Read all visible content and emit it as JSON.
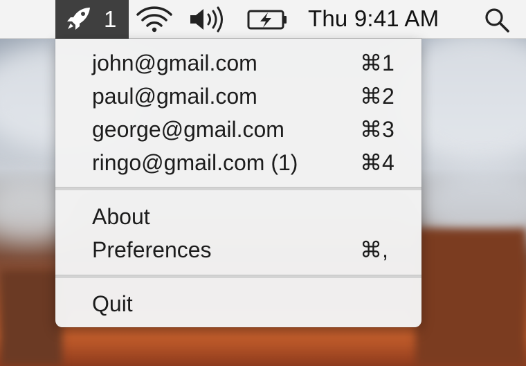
{
  "menubar": {
    "status_app": {
      "icon": "rocket-icon",
      "unread_count": "1"
    },
    "tray": {
      "wifi_icon": "wifi-icon",
      "volume_icon": "volume-icon",
      "battery_icon": "battery-charging-icon",
      "search_icon": "search-icon"
    },
    "clock": "Thu 9:41 AM"
  },
  "menu": {
    "accounts": [
      {
        "label": "john@gmail.com",
        "shortcut": "⌘1"
      },
      {
        "label": "paul@gmail.com",
        "shortcut": "⌘2"
      },
      {
        "label": "george@gmail.com",
        "shortcut": "⌘3"
      },
      {
        "label": "ringo@gmail.com (1)",
        "shortcut": "⌘4"
      }
    ],
    "about_label": "About",
    "preferences_label": "Preferences",
    "preferences_shortcut": "⌘,",
    "quit_label": "Quit"
  }
}
